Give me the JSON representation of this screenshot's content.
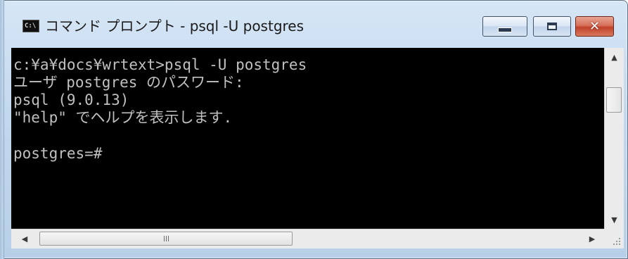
{
  "window": {
    "title": "コマンド プロンプト - psql  -U postgres",
    "app_icon_text": "C:\\",
    "controls": {
      "minimize": "minimize",
      "maximize": "maximize",
      "close": "✕"
    }
  },
  "console": {
    "lines": [
      "c:¥a¥docs¥wrtext>psql -U postgres",
      "ユーザ postgres のパスワード:",
      "psql (9.0.13)",
      "\"help\" でヘルプを表示します.",
      "",
      "postgres=#"
    ]
  },
  "scrollbars": {
    "vertical": {
      "up": "▲",
      "down": "▼"
    },
    "horizontal": {
      "left": "◀",
      "right": "▶"
    }
  },
  "colors": {
    "console_bg": "#000000",
    "console_text": "#c0c0c0",
    "close_button": "#c1412a",
    "title_bar": "#c2d8ee"
  },
  "icons": [
    "console-app-icon",
    "minimize-icon",
    "maximize-icon",
    "close-icon",
    "scroll-up-icon",
    "scroll-down-icon",
    "scroll-left-icon",
    "scroll-right-icon",
    "size-grip-icon"
  ]
}
